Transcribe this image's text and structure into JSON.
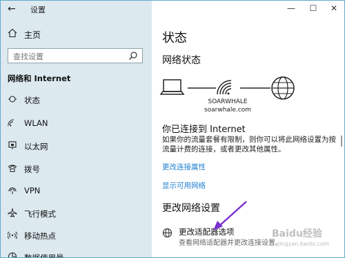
{
  "app": {
    "title": "设置"
  },
  "window_controls": {
    "minimize": "—",
    "maximize": "☐",
    "close": "✕"
  },
  "sidebar": {
    "home": "主页",
    "search_placeholder": "查找设置",
    "section": "网络和 Internet",
    "items": [
      {
        "label": "状态",
        "icon": "status-icon"
      },
      {
        "label": "WLAN",
        "icon": "wifi-icon"
      },
      {
        "label": "以太网",
        "icon": "ethernet-icon"
      },
      {
        "label": "拨号",
        "icon": "dialup-icon"
      },
      {
        "label": "VPN",
        "icon": "vpn-icon"
      },
      {
        "label": "飞行模式",
        "icon": "airplane-icon"
      },
      {
        "label": "移动热点",
        "icon": "hotspot-icon"
      },
      {
        "label": "数据使用量",
        "icon": "data-usage-icon"
      }
    ]
  },
  "main": {
    "title": "状态",
    "network_status": "网络状态",
    "network_name": "SOARWHALE",
    "network_domain": "soarwhale.com",
    "connected_title": "你已连接到 Internet",
    "connected_desc": "如果你的流量套餐有限制，则你可以将此网络设置为按流量计费的连接，或者更改其他属性。",
    "link_change_props": "更改连接属性",
    "link_show_networks": "显示可用网络",
    "change_settings": "更改网络设置",
    "adapter_title": "更改适配器选项",
    "adapter_desc": "查看网络适配器并更改连接设置。"
  },
  "watermark": {
    "text": "Baidu经验",
    "url": "jingyan.baidu.com"
  },
  "colors": {
    "sidebar_bg": "#dce9ef",
    "link": "#1f7fd1",
    "arrow": "#7b2fd0"
  }
}
